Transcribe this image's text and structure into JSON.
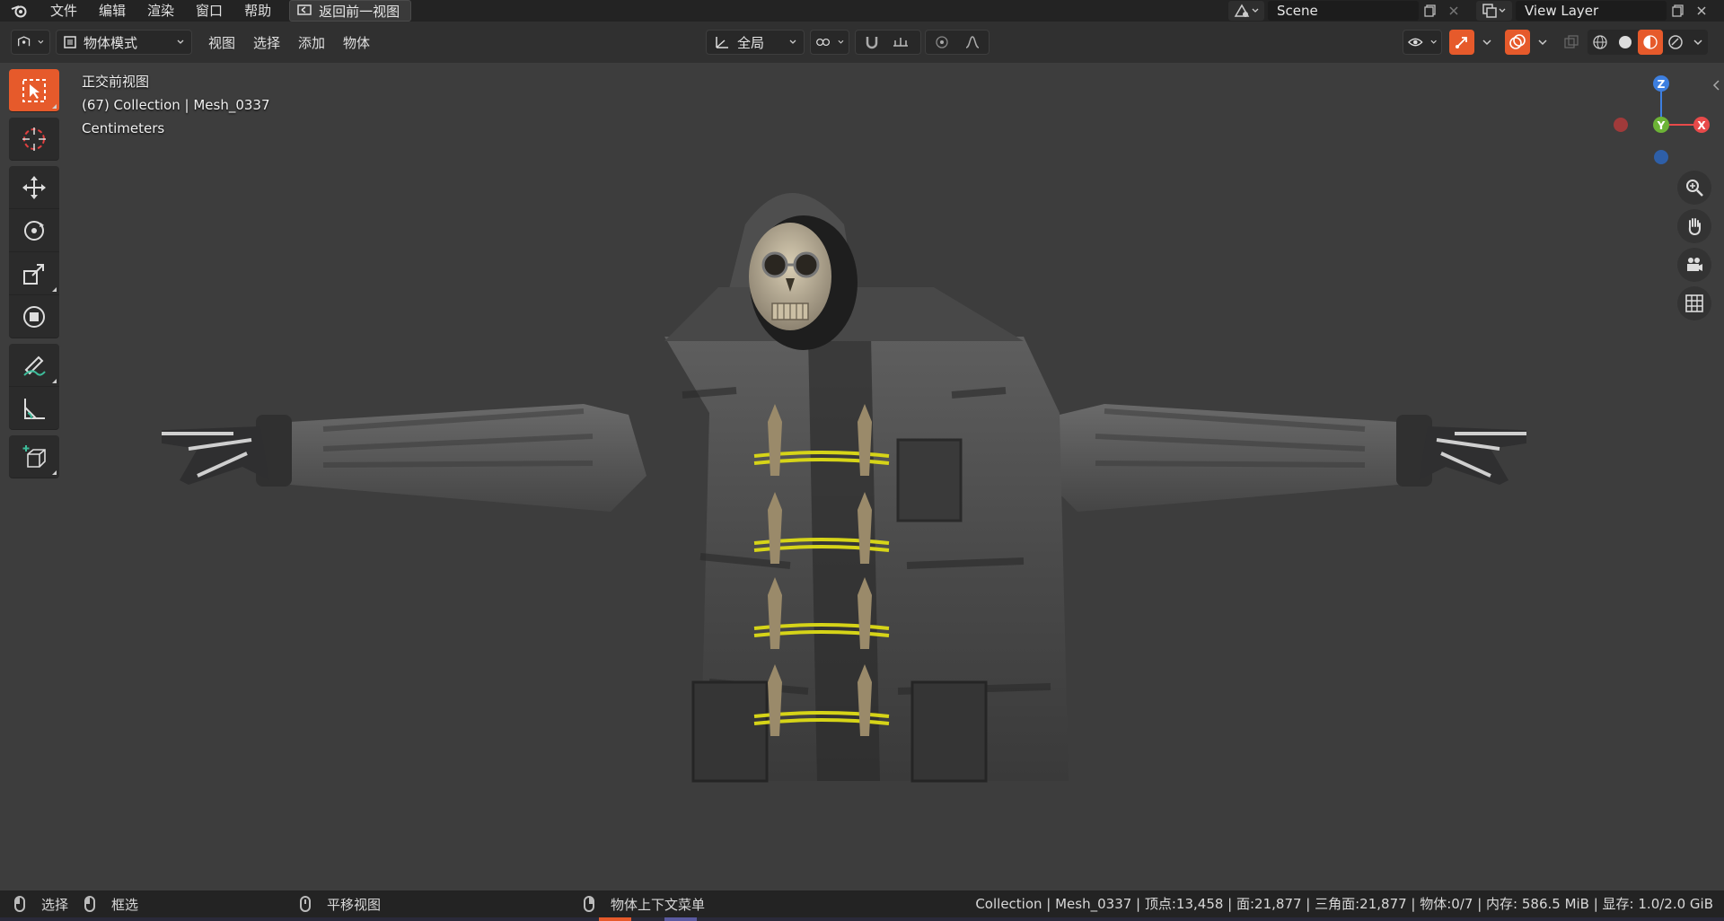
{
  "topbar": {
    "menu": [
      "文件",
      "编辑",
      "渲染",
      "窗口",
      "帮助"
    ],
    "back_button": "返回前一视图",
    "scene_name": "Scene",
    "view_layer": "View Layer"
  },
  "header": {
    "mode": "物体模式",
    "menus": [
      "视图",
      "选择",
      "添加",
      "物体"
    ],
    "transform_orientation": "全局"
  },
  "viewport": {
    "view_name": "正交前视图",
    "collection_info": "(67) Collection | Mesh_0337",
    "units": "Centimeters"
  },
  "gizmo": {
    "z": "Z",
    "y": "Y",
    "x": "X"
  },
  "statusbar": {
    "select": "选择",
    "box_select": "框选",
    "pan_view": "平移视图",
    "context_menu": "物体上下文菜单",
    "stats": "Collection | Mesh_0337 | 顶点:13,458 | 面:21,877 | 三角面:21,877 | 物体:0/7 | 内存: 586.5 MiB | 显存: 1.0/2.0 GiB"
  },
  "colors": {
    "accent": "#e65a2b",
    "x_axis": "#e84a4a",
    "y_axis": "#6cb336",
    "z_axis": "#3d7fe0"
  }
}
